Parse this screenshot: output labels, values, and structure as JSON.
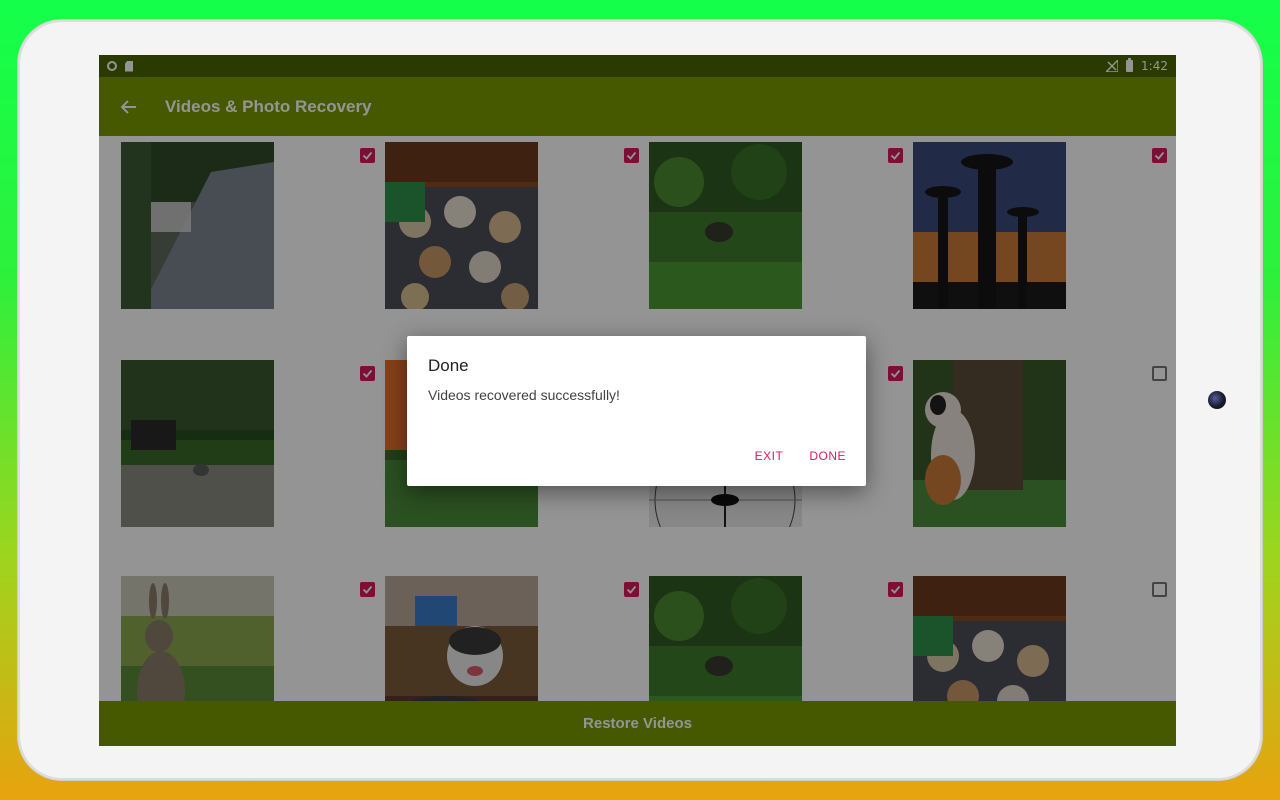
{
  "statusbar": {
    "time": "1:42"
  },
  "appbar": {
    "title": "Videos & Photo Recovery"
  },
  "grid": {
    "items": [
      {
        "checked": true,
        "scene": "street"
      },
      {
        "checked": true,
        "scene": "rug"
      },
      {
        "checked": true,
        "scene": "jungle"
      },
      {
        "checked": true,
        "scene": "baobab"
      },
      {
        "checked": true,
        "scene": "park"
      },
      {
        "checked": true,
        "scene": "orange"
      },
      {
        "checked": true,
        "scene": "circle"
      },
      {
        "checked": false,
        "scene": "cat"
      },
      {
        "checked": true,
        "scene": "rabbit"
      },
      {
        "checked": true,
        "scene": "husky"
      },
      {
        "checked": true,
        "scene": "jungle"
      },
      {
        "checked": false,
        "scene": "rug"
      }
    ]
  },
  "restore_button": {
    "label": "Restore Videos"
  },
  "dialog": {
    "title": "Done",
    "message": "Videos recovered successfully!",
    "exit_label": "EXIT",
    "done_label": "DONE"
  },
  "colors": {
    "appbar": "#7a9900",
    "statusbar": "#4a6600",
    "accent": "#d81b60"
  }
}
